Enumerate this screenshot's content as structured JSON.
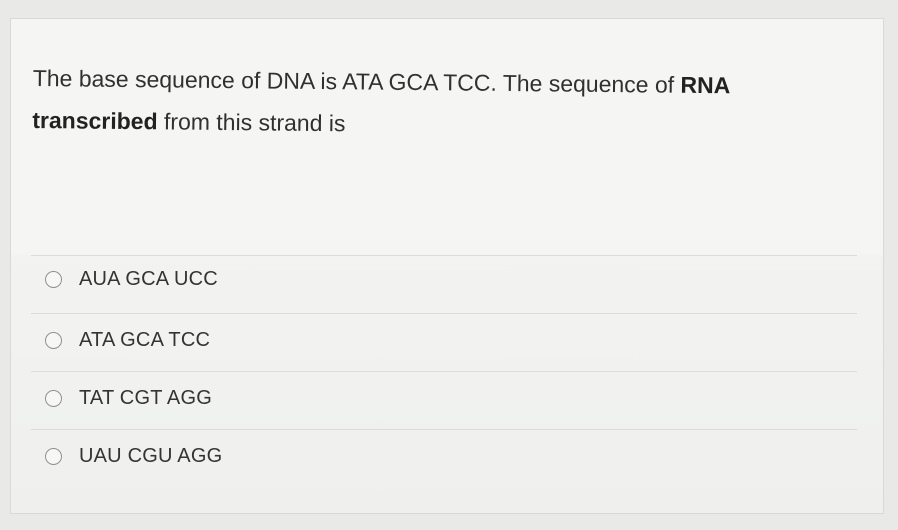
{
  "question": {
    "text_before": "The base sequence of DNA is ATA GCA TCC. The sequence of ",
    "bold_1": "RNA",
    "bold_2": "transcribed",
    "text_after": " from this strand is"
  },
  "options": [
    {
      "label": "AUA GCA UCC",
      "selected": false
    },
    {
      "label": "ATA GCA TCC",
      "selected": false
    },
    {
      "label": "TAT CGT AGG",
      "selected": false
    },
    {
      "label": "UAU CGU AGG",
      "selected": false
    }
  ]
}
